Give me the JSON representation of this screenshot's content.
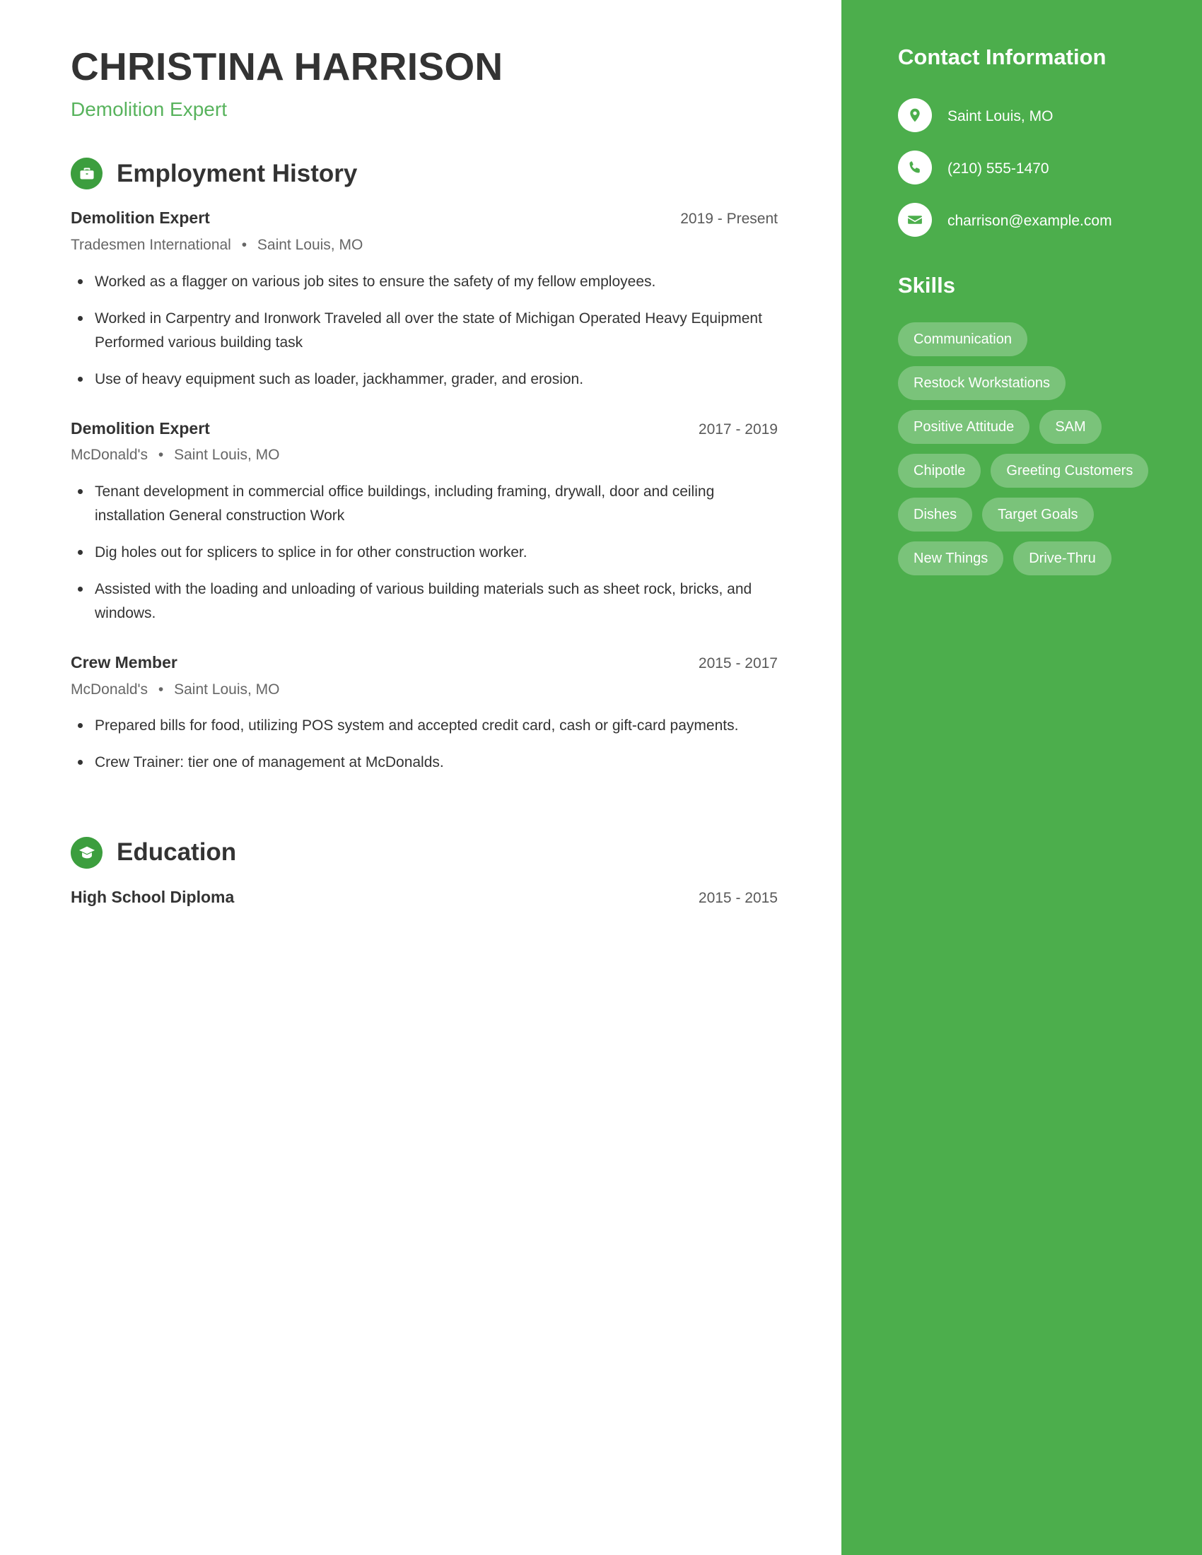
{
  "header": {
    "name": "CHRISTINA HARRISON",
    "job_title": "Demolition Expert"
  },
  "sections": {
    "employment": {
      "title": "Employment History",
      "icon": "briefcase-icon"
    },
    "education": {
      "title": "Education",
      "icon": "graduation-cap-icon"
    }
  },
  "employment_entries": [
    {
      "role": "Demolition Expert",
      "dates": "2019 - Present",
      "company": "Tradesmen International",
      "location": "Saint Louis, MO",
      "bullets": [
        "Worked as a flagger on various job sites to ensure the safety of my fellow employees.",
        "Worked in Carpentry and Ironwork Traveled all over the state of Michigan Operated Heavy Equipment Performed various building task",
        "Use of heavy equipment such as loader, jackhammer, grader, and erosion."
      ]
    },
    {
      "role": "Demolition Expert",
      "dates": "2017 - 2019",
      "company": "McDonald's",
      "location": "Saint Louis, MO",
      "bullets": [
        "Tenant development in commercial office buildings, including framing, drywall, door and ceiling installation General construction Work",
        "Dig holes out for splicers to splice in for other construction worker.",
        "Assisted with the loading and unloading of various building materials such as sheet rock, bricks, and windows."
      ]
    },
    {
      "role": "Crew Member",
      "dates": "2015 - 2017",
      "company": "McDonald's",
      "location": "Saint Louis, MO",
      "bullets": [
        "Prepared bills for food, utilizing POS system and accepted credit card, cash or gift-card payments.",
        "Crew Trainer: tier one of management at McDonalds."
      ]
    }
  ],
  "education_entries": [
    {
      "degree": "High School Diploma",
      "dates": "2015 - 2015"
    }
  ],
  "sidebar": {
    "contact_title": "Contact Information",
    "contact_items": [
      {
        "icon": "map-pin-icon",
        "value": "Saint Louis, MO"
      },
      {
        "icon": "phone-icon",
        "value": "(210) 555-1470"
      },
      {
        "icon": "envelope-icon",
        "value": "charrison@example.com"
      }
    ],
    "skills_title": "Skills",
    "skills": [
      "Communication",
      "Restock Workstations",
      "Positive Attitude",
      "SAM",
      "Chipotle",
      "Greeting Customers",
      "Dishes",
      "Target Goals",
      "New Things",
      "Drive-Thru"
    ]
  },
  "colors": {
    "sidebar_green": "#4cae4c",
    "accent_green": "#58b35d",
    "icon_green": "#3c9e3e",
    "text_dark": "#333333",
    "text_muted": "#666666"
  },
  "separator": "•"
}
